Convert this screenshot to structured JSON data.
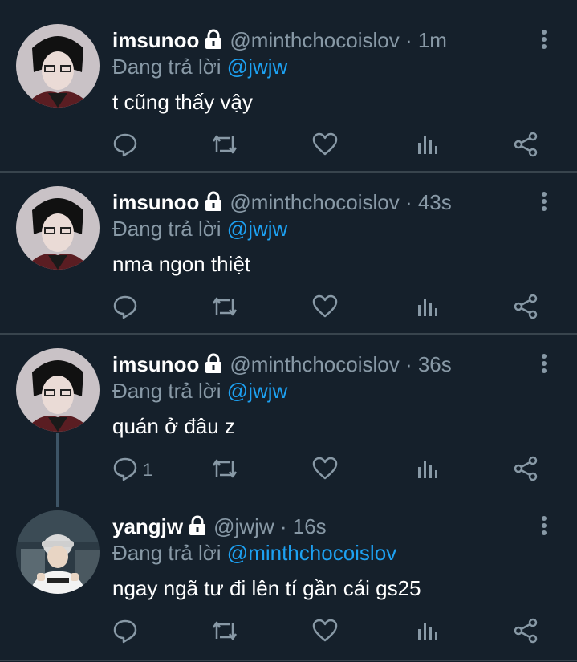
{
  "tweets": [
    {
      "name": "imsunoo",
      "handle": "@minthchocoislov",
      "time": "· 1m",
      "reply_prefix": "Đang trả lời",
      "reply_to": "@jwjw",
      "text": "t cũng thấy vậy",
      "reply_count": ""
    },
    {
      "name": "imsunoo",
      "handle": "@minthchocoislov",
      "time": "· 43s",
      "reply_prefix": "Đang trả lời",
      "reply_to": "@jwjw",
      "text": "nma ngon thiệt",
      "reply_count": ""
    },
    {
      "name": "imsunoo",
      "handle": "@minthchocoislov",
      "time": "· 36s",
      "reply_prefix": "Đang trả lời",
      "reply_to": "@jwjw",
      "text": "quán ở đâu z",
      "reply_count": "1"
    },
    {
      "name": "yangjw",
      "handle": "@jwjw",
      "time": "· 16s",
      "reply_prefix": "Đang trả lời",
      "reply_to": "@minthchocoislov",
      "text": "ngay ngã tư đi lên tí gần cái gs25",
      "reply_count": ""
    }
  ],
  "icons": {
    "reply": "reply-icon",
    "retweet": "retweet-icon",
    "like": "heart-icon",
    "analytics": "analytics-icon",
    "share": "share-icon",
    "more": "more-vertical-icon",
    "lock": "lock-icon"
  },
  "colors": {
    "background": "#15202b",
    "secondary_text": "#8899a6",
    "mention": "#1da1f2",
    "divider": "#38444d"
  }
}
